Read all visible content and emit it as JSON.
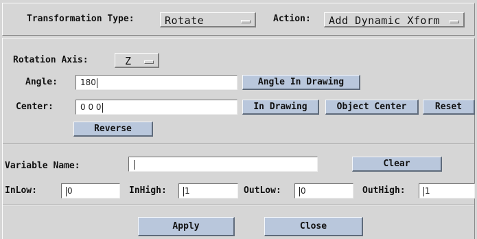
{
  "transform": {
    "type_label": "Transformation Type:",
    "type_value": "Rotate",
    "action_label": "Action:",
    "action_value": "Add Dynamic Xform"
  },
  "rotation": {
    "axis_label": "Rotation Axis:",
    "axis_value": "Z",
    "angle_label": "Angle:",
    "angle_value": "180",
    "angle_in_drawing_btn": "Angle In Drawing",
    "center_label": "Center:",
    "center_value": "0 0 0",
    "in_drawing_btn": "In Drawing",
    "object_center_btn": "Object Center",
    "reset_btn": "Reset",
    "reverse_btn": "Reverse"
  },
  "variable": {
    "name_label": "Variable Name:",
    "name_value": "",
    "clear_btn": "Clear",
    "inlow_label": "InLow:",
    "inlow_value": "0",
    "inhigh_label": "InHigh:",
    "inhigh_value": "1",
    "outlow_label": "OutLow:",
    "outlow_value": "0",
    "outhigh_label": "OutHigh:",
    "outhigh_value": "1"
  },
  "footer": {
    "apply_btn": "Apply",
    "close_btn": "Close"
  }
}
